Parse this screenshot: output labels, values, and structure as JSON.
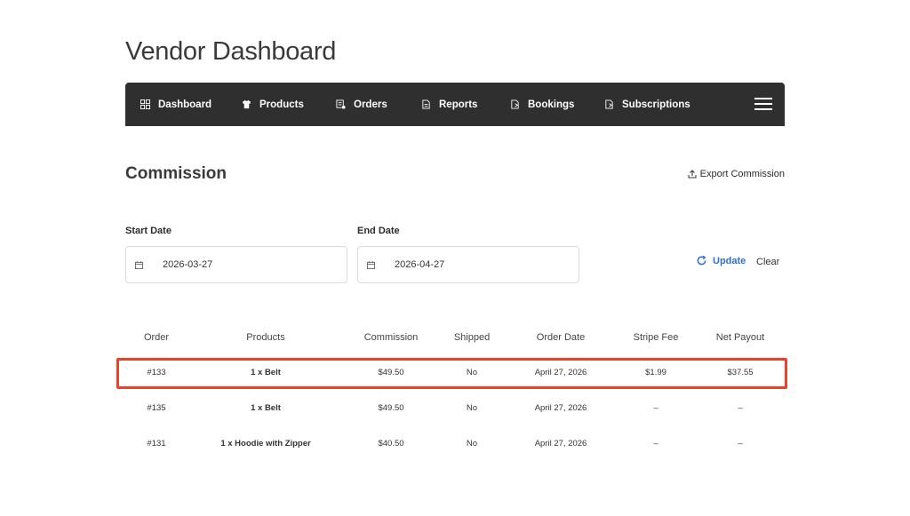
{
  "page": {
    "title": "Vendor Dashboard"
  },
  "nav": {
    "items": [
      {
        "label": "Dashboard",
        "icon": "dashboard-grid-icon"
      },
      {
        "label": "Products",
        "icon": "shirt-icon"
      },
      {
        "label": "Orders",
        "icon": "orders-icon"
      },
      {
        "label": "Reports",
        "icon": "report-icon"
      },
      {
        "label": "Bookings",
        "icon": "booking-icon"
      },
      {
        "label": "Subscriptions",
        "icon": "subscription-icon"
      }
    ],
    "menu_icon": "hamburger-menu-icon"
  },
  "section": {
    "title": "Commission",
    "export_label": "Export Commission"
  },
  "filters": {
    "start_label": "Start Date",
    "start_value": "2026-03-27",
    "end_label": "End Date",
    "end_value": "2026-04-27",
    "update_label": "Update",
    "clear_label": "Clear"
  },
  "table": {
    "headers": [
      "Order",
      "Products",
      "Commission",
      "Shipped",
      "Order Date",
      "Stripe Fee",
      "Net Payout"
    ],
    "rows": [
      [
        "#133",
        "1 x Belt",
        "$49.50",
        "No",
        "April 27, 2026",
        "$1.99",
        "$37.55"
      ],
      [
        "#135",
        "1 x Belt",
        "$49.50",
        "No",
        "April 27, 2026",
        "–",
        "–"
      ],
      [
        "#131",
        "1 x Hoodie with Zipper",
        "$40.50",
        "No",
        "April 27, 2026",
        "–",
        "–"
      ]
    ]
  },
  "colors": {
    "navbar": "#2f2f2f",
    "accent": "#2f6fd6",
    "highlight": "#e8432b"
  }
}
